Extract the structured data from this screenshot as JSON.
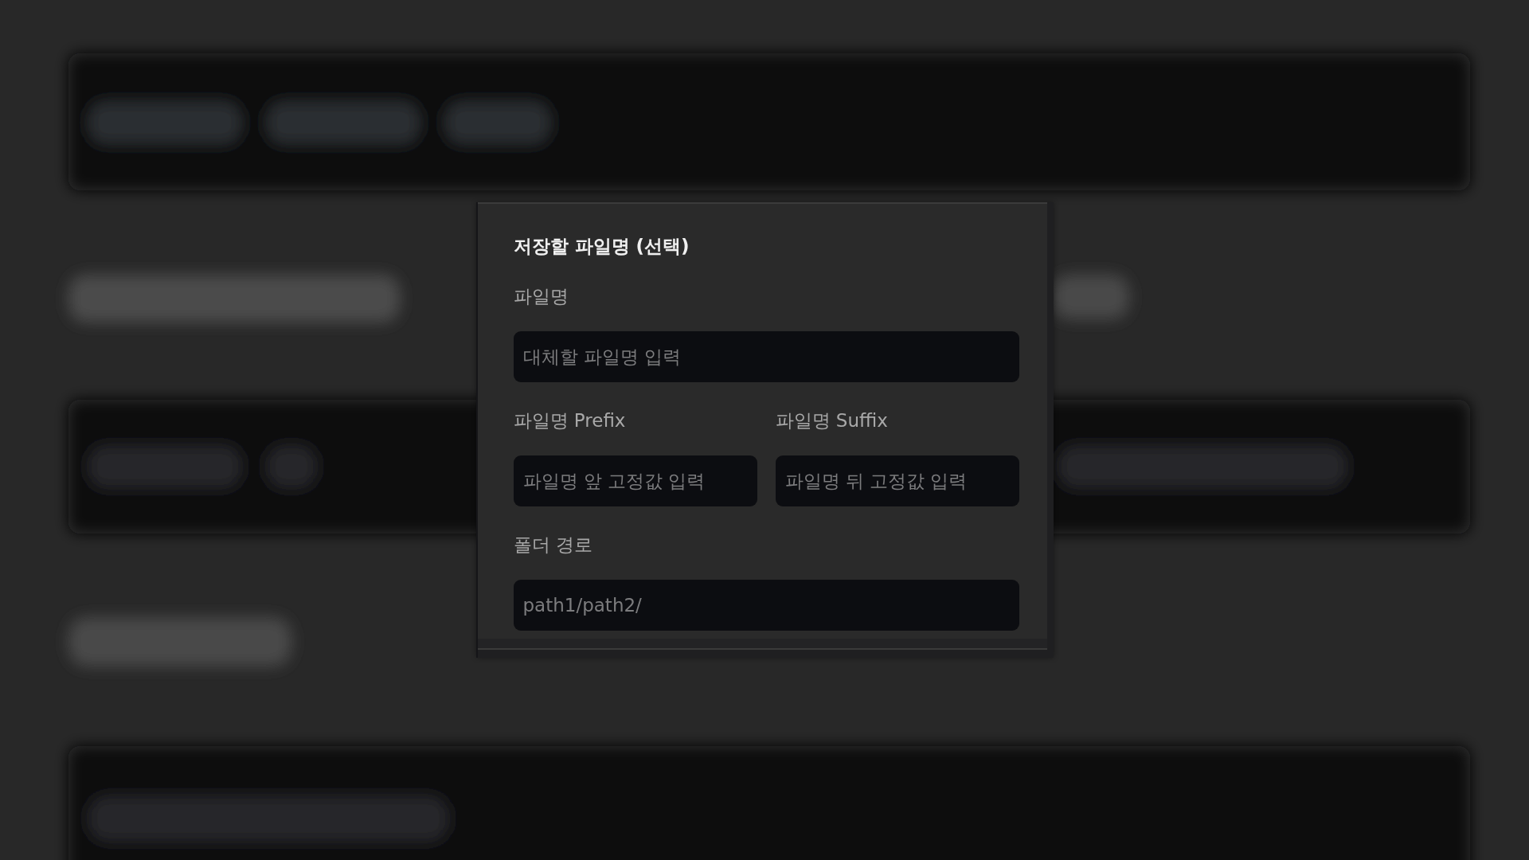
{
  "dialog": {
    "title": "저장할 파일명 (선택)",
    "rows": [
      {
        "fields": [
          {
            "label": "파일명",
            "placeholder": "대체할 파일명 입력"
          }
        ]
      },
      {
        "fields": [
          {
            "label": "파일명 Prefix",
            "placeholder": "파일명 앞 고정값 입력"
          },
          {
            "label": "파일명 Suffix",
            "placeholder": "파일명 뒤 고정값 입력"
          }
        ]
      },
      {
        "fields": [
          {
            "label": "폴더 경로",
            "placeholder": "path1/path2/"
          }
        ]
      }
    ]
  }
}
